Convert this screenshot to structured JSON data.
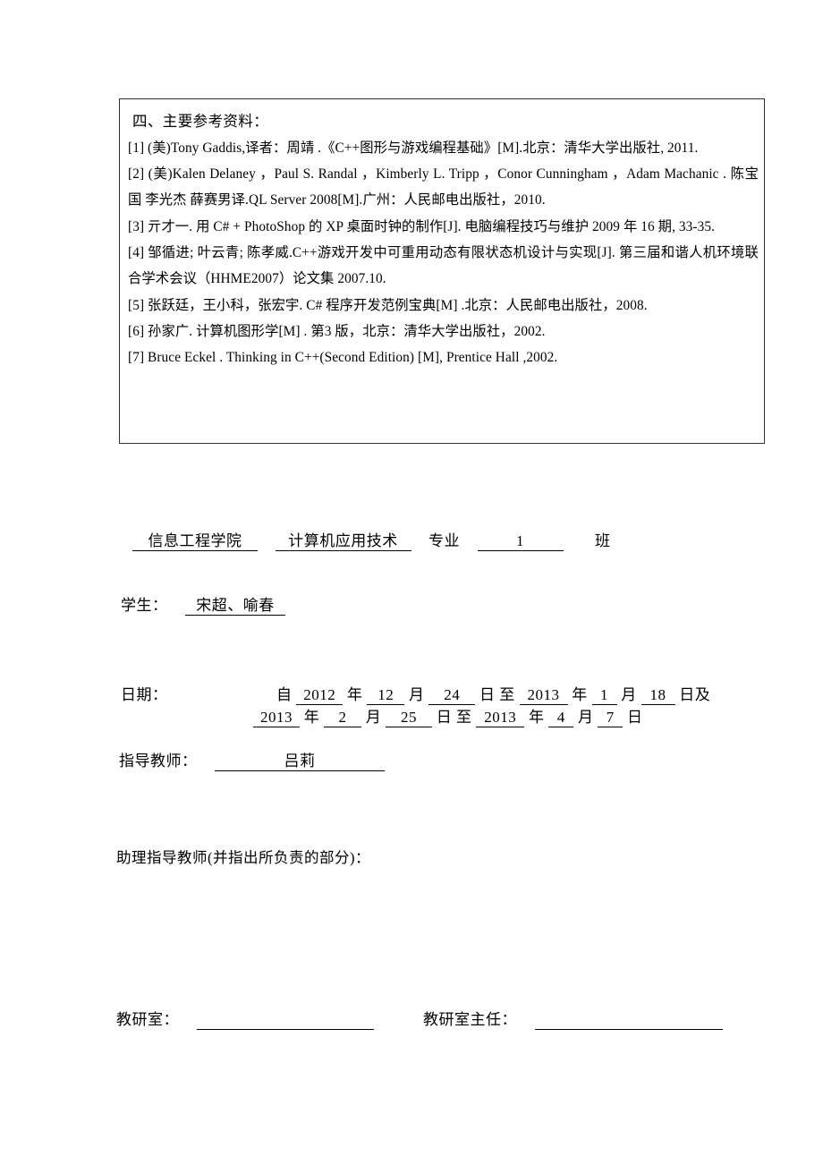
{
  "document": {
    "references_section": {
      "heading": "四、主要参考资料：",
      "items": [
        "[1] (美)Tony Gaddis,译者：周靖 .《C++图形与游戏编程基础》[M].北京：清华大学出版社, 2011.",
        "[2] (美)Kalen Delaney ，Paul S. Randal ，Kimberly L. Tripp ，Conor Cunningham ，Adam Machanic . 陈宝国 李光杰 薛赛男译.QL Server 2008[M].广州：人民邮电出版社，2010.",
        "[3] 亓才一. 用 C# + PhotoShop 的 XP 桌面时钟的制作[J]. 电脑编程技巧与维护 2009 年 16 期, 33-35.",
        "[4] 邹循进; 叶云青; 陈孝威.C++游戏开发中可重用动态有限状态机设计与实现[J]. 第三届和谐人机环境联合学术会议（HHME2007）论文集 2007.10.",
        "[5] 张跃廷，王小科，张宏宇. C# 程序开发范例宝典[M] .北京：人民邮电出版社，2008.",
        "[6] 孙家广. 计算机图形学[M] . 第3 版，北京：清华大学出版社，2002.",
        "[7] Bruce Eckel . Thinking in C++(Second Edition)   [M], Prentice Hall ,2002."
      ]
    },
    "form": {
      "department": {
        "value": "信息工程学院",
        "major_value": "计算机应用技术",
        "major_label": "专业",
        "class_value": "1",
        "class_label": "班"
      },
      "student": {
        "label": "学生：",
        "value": "宋超、喻春"
      },
      "date": {
        "label": "日期：",
        "from_prefix": "自",
        "line1": {
          "year1": "2012",
          "year_unit": "年",
          "month1": "12",
          "month_unit": "月",
          "day1": "24",
          "day_unit": "日",
          "to": "至",
          "year2": "2013",
          "month2": "1",
          "day2": "18",
          "suffix": "日及"
        },
        "line2": {
          "year1": "2013",
          "year_unit": "年",
          "month1": "2",
          "month_unit": "月",
          "day1": "25",
          "day_unit": "日",
          "to": "至",
          "year2": "2013",
          "month2": "4",
          "day2": "7",
          "suffix": "日"
        }
      },
      "advisor": {
        "label": "指导教师：",
        "value": "吕莉"
      },
      "assistant_advisor": {
        "label": "助理指导教师(并指出所负责的部分)："
      },
      "office": {
        "label": "教研室：",
        "value": "",
        "director_label": "教研室主任：",
        "director_value": ""
      }
    }
  }
}
